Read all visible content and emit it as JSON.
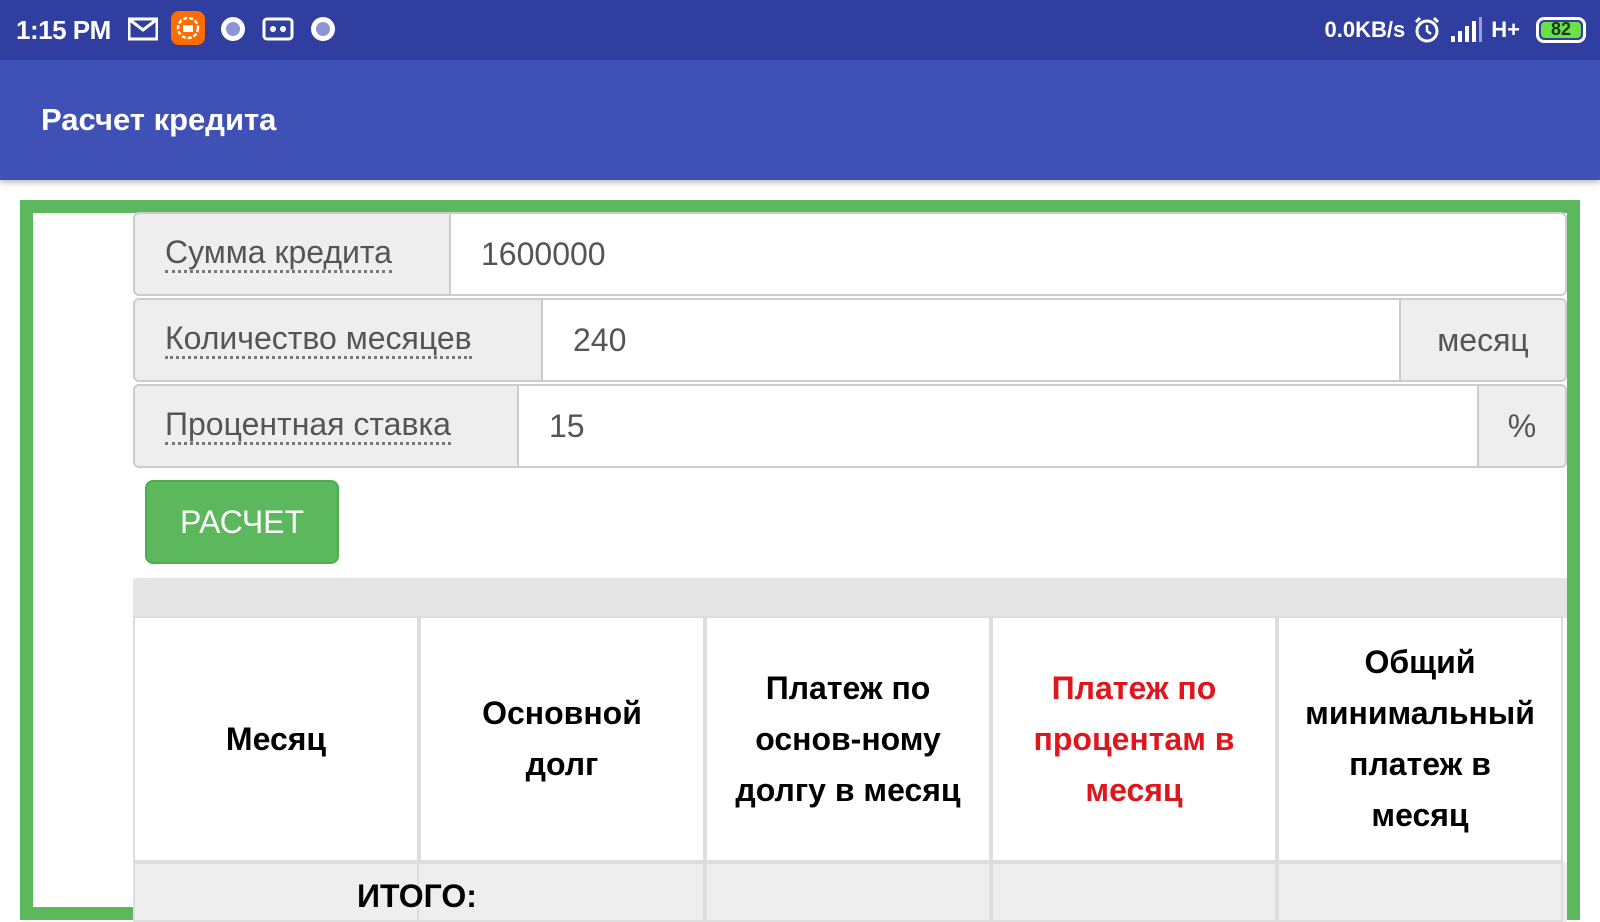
{
  "status_bar": {
    "time": "1:15 PM",
    "net_speed": "0.0KB/s",
    "network_type": "H+",
    "battery": "82"
  },
  "app_bar": {
    "title": "Расчет кредита"
  },
  "form": {
    "amount": {
      "label": "Сумма кредита",
      "value": "1600000"
    },
    "months": {
      "label": "Количество месяцев",
      "value": "240",
      "suffix": "месяц"
    },
    "rate": {
      "label": "Процентная ставка",
      "value": "15",
      "suffix": "%"
    },
    "calc_button": "РАСЧЕТ"
  },
  "table": {
    "headers": [
      {
        "lines": [
          "Месяц"
        ]
      },
      {
        "lines": [
          "Основной",
          "долг"
        ]
      },
      {
        "lines": [
          "Платеж по",
          "основ-ному",
          "долгу в месяц"
        ]
      },
      {
        "lines": [
          "Платеж по",
          "процентам в",
          "месяц"
        ],
        "color": "#e0161d"
      },
      {
        "lines": [
          "Общий",
          "минимальный",
          "платеж в",
          "месяц"
        ]
      }
    ],
    "total_label": "ИТОГО:"
  },
  "colors": {
    "status_bar": "#303f9f",
    "app_bar": "#3f51b5",
    "frame": "#5cb85c",
    "button": "#5cb85c",
    "accent_red": "#e0161d"
  }
}
